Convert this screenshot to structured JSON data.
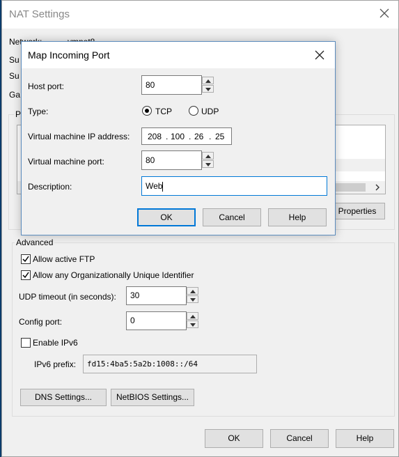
{
  "nat_window": {
    "title": "NAT Settings",
    "network_label": "Network:",
    "network_value": "vmnet8",
    "subnet_ip_label_partial": "Su",
    "subnet_mask_label_partial": "Su",
    "gateway_label_partial": "Ga",
    "port_forwarding_label_partial": "P",
    "properties_button": "Properties",
    "advanced": {
      "group_label": "Advanced",
      "allow_active_ftp": "Allow active FTP",
      "allow_active_ftp_checked": true,
      "allow_oui": "Allow any Organizationally Unique Identifier",
      "allow_oui_checked": true,
      "udp_timeout_label": "UDP timeout (in seconds):",
      "udp_timeout_value": "30",
      "config_port_label": "Config port:",
      "config_port_value": "0",
      "enable_ipv6": "Enable IPv6",
      "enable_ipv6_checked": false,
      "ipv6_prefix_label": "IPv6 prefix:",
      "ipv6_prefix_value": "fd15:4ba5:5a2b:1008::/64",
      "dns_settings_button": "DNS Settings...",
      "netbios_settings_button": "NetBIOS Settings..."
    },
    "ok_button": "OK",
    "cancel_button": "Cancel",
    "help_button": "Help"
  },
  "map_port_dialog": {
    "title": "Map Incoming Port",
    "host_port_label": "Host port:",
    "host_port_value": "80",
    "type_label": "Type:",
    "tcp_label": "TCP",
    "udp_label": "UDP",
    "selected_type": "TCP",
    "vm_ip_label": "Virtual machine IP address:",
    "vm_ip_octets": [
      "208",
      "100",
      "26",
      "25"
    ],
    "vm_port_label": "Virtual machine port:",
    "vm_port_value": "80",
    "description_label": "Description:",
    "description_value": "Web",
    "ok_button": "OK",
    "cancel_button": "Cancel",
    "help_button": "Help"
  }
}
